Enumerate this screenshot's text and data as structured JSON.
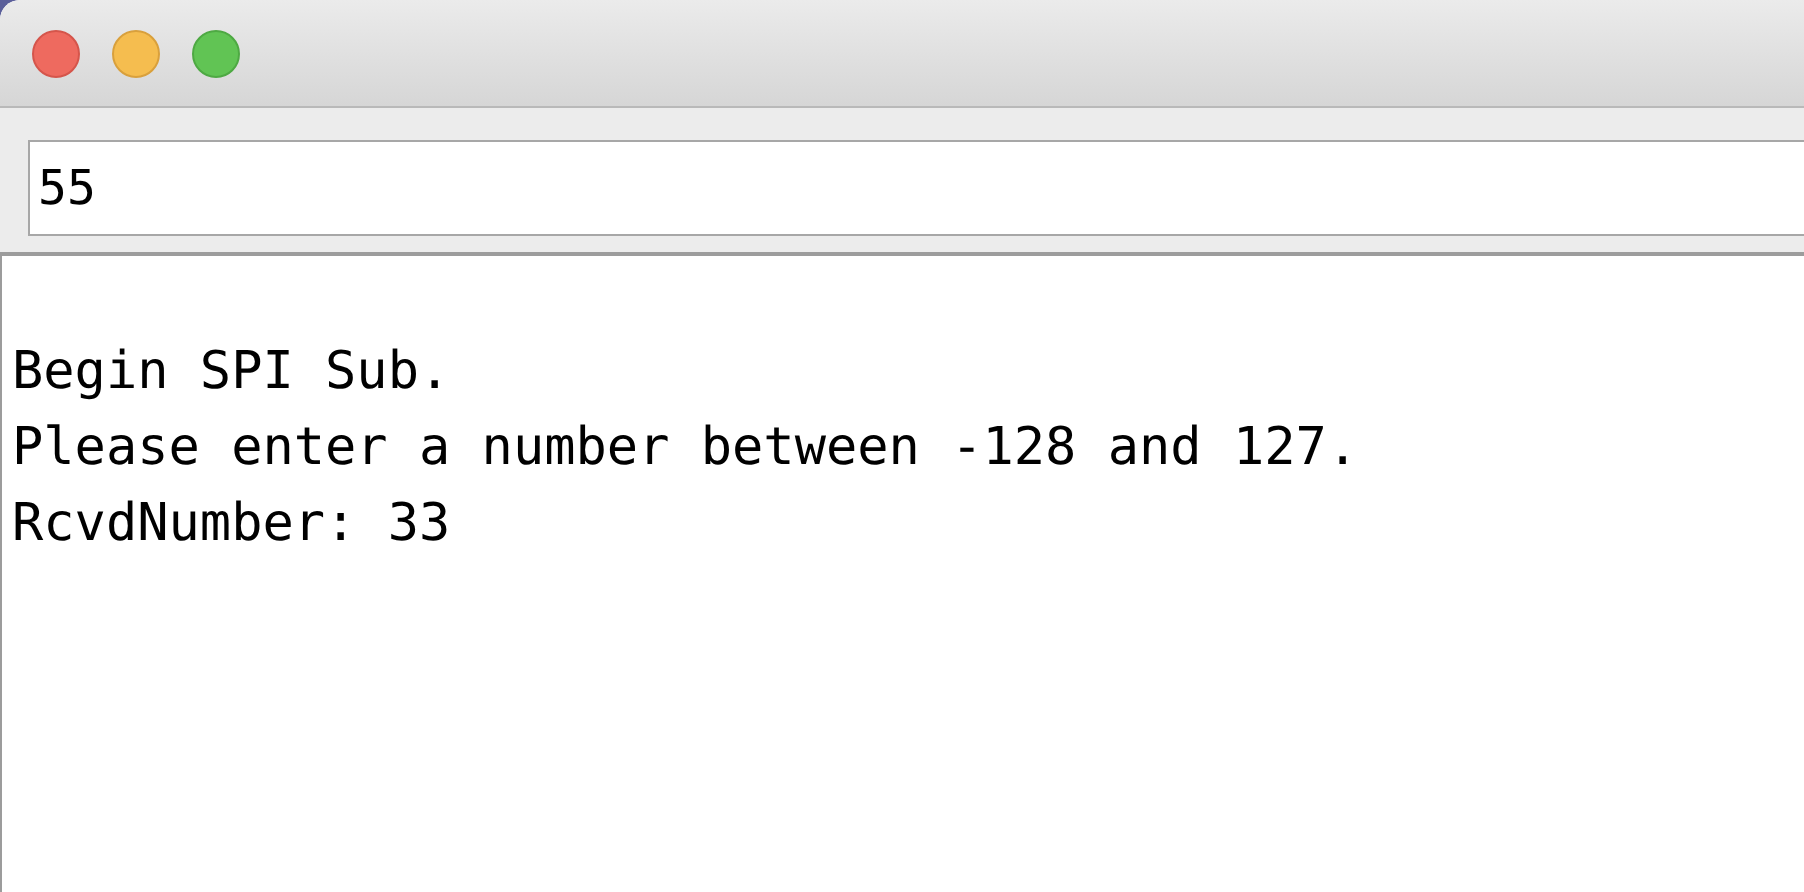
{
  "input": {
    "value": "55"
  },
  "output": {
    "lines": [
      "Begin SPI Sub.",
      "Please enter a number between -128 and 127.",
      "RcvdNumber: 33"
    ]
  }
}
